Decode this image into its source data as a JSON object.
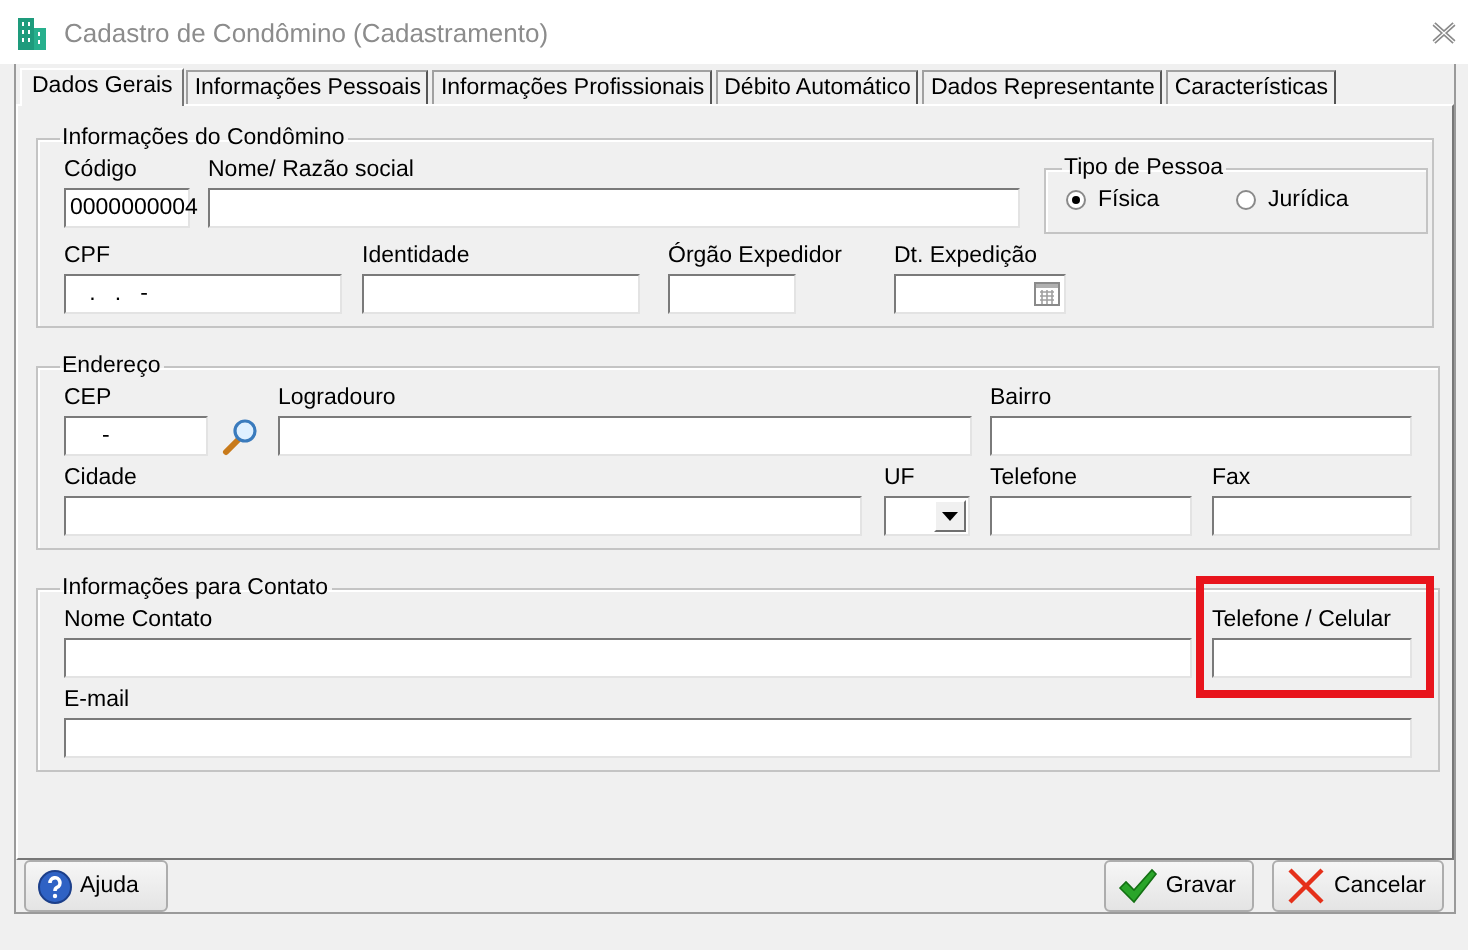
{
  "window": {
    "title": "Cadastro de Condômino (Cadastramento)"
  },
  "tabs": [
    {
      "label": "Dados Gerais",
      "selected": true
    },
    {
      "label": "Informações Pessoais",
      "selected": false
    },
    {
      "label": "Informações Profissionais",
      "selected": false
    },
    {
      "label": "Débito Automático",
      "selected": false
    },
    {
      "label": "Dados Representante",
      "selected": false
    },
    {
      "label": "Características",
      "selected": false
    }
  ],
  "groups": [
    {
      "title": "Informações do Condômino",
      "rows": [
        [
          {
            "label": "Código",
            "value": "0000000004",
            "kind": "text"
          },
          {
            "label": "Nome/ Razão social",
            "kind": "text"
          }
        ],
        [
          {
            "label": "CPF",
            "value": "   .   .   -",
            "kind": "text"
          },
          {
            "label": "Identidade",
            "kind": "text"
          },
          {
            "label": "Órgão Expedidor",
            "kind": "text"
          },
          {
            "label": "Dt. Expedição",
            "kind": "date"
          }
        ]
      ],
      "radio_group": {
        "title": "Tipo de Pessoa",
        "options": [
          {
            "label": "Física",
            "selected": true
          },
          {
            "label": "Jurídica",
            "selected": false
          }
        ]
      }
    },
    {
      "title": "Endereço",
      "rows": [
        [
          {
            "label": "CEP",
            "value": "     -",
            "kind": "search"
          },
          {
            "label": "Logradouro",
            "kind": "text"
          },
          {
            "label": "Bairro",
            "kind": "text"
          }
        ],
        [
          {
            "label": "Cidade",
            "kind": "text"
          },
          {
            "label": "UF",
            "kind": "select"
          },
          {
            "label": "Telefone",
            "kind": "text"
          },
          {
            "label": "Fax",
            "kind": "text"
          }
        ]
      ]
    },
    {
      "title": "Informações para Contato",
      "rows": [
        [
          {
            "label": "Nome Contato",
            "kind": "text"
          },
          {
            "label": "Telefone / Celular",
            "kind": "text",
            "highlighted": true
          }
        ],
        [
          {
            "label": "E-mail",
            "kind": "text"
          }
        ]
      ]
    }
  ],
  "buttons": [
    {
      "label": "Ajuda",
      "kind": "help"
    },
    {
      "label": "Gravar",
      "kind": "save"
    },
    {
      "label": "Cancelar",
      "kind": "cancel"
    }
  ]
}
